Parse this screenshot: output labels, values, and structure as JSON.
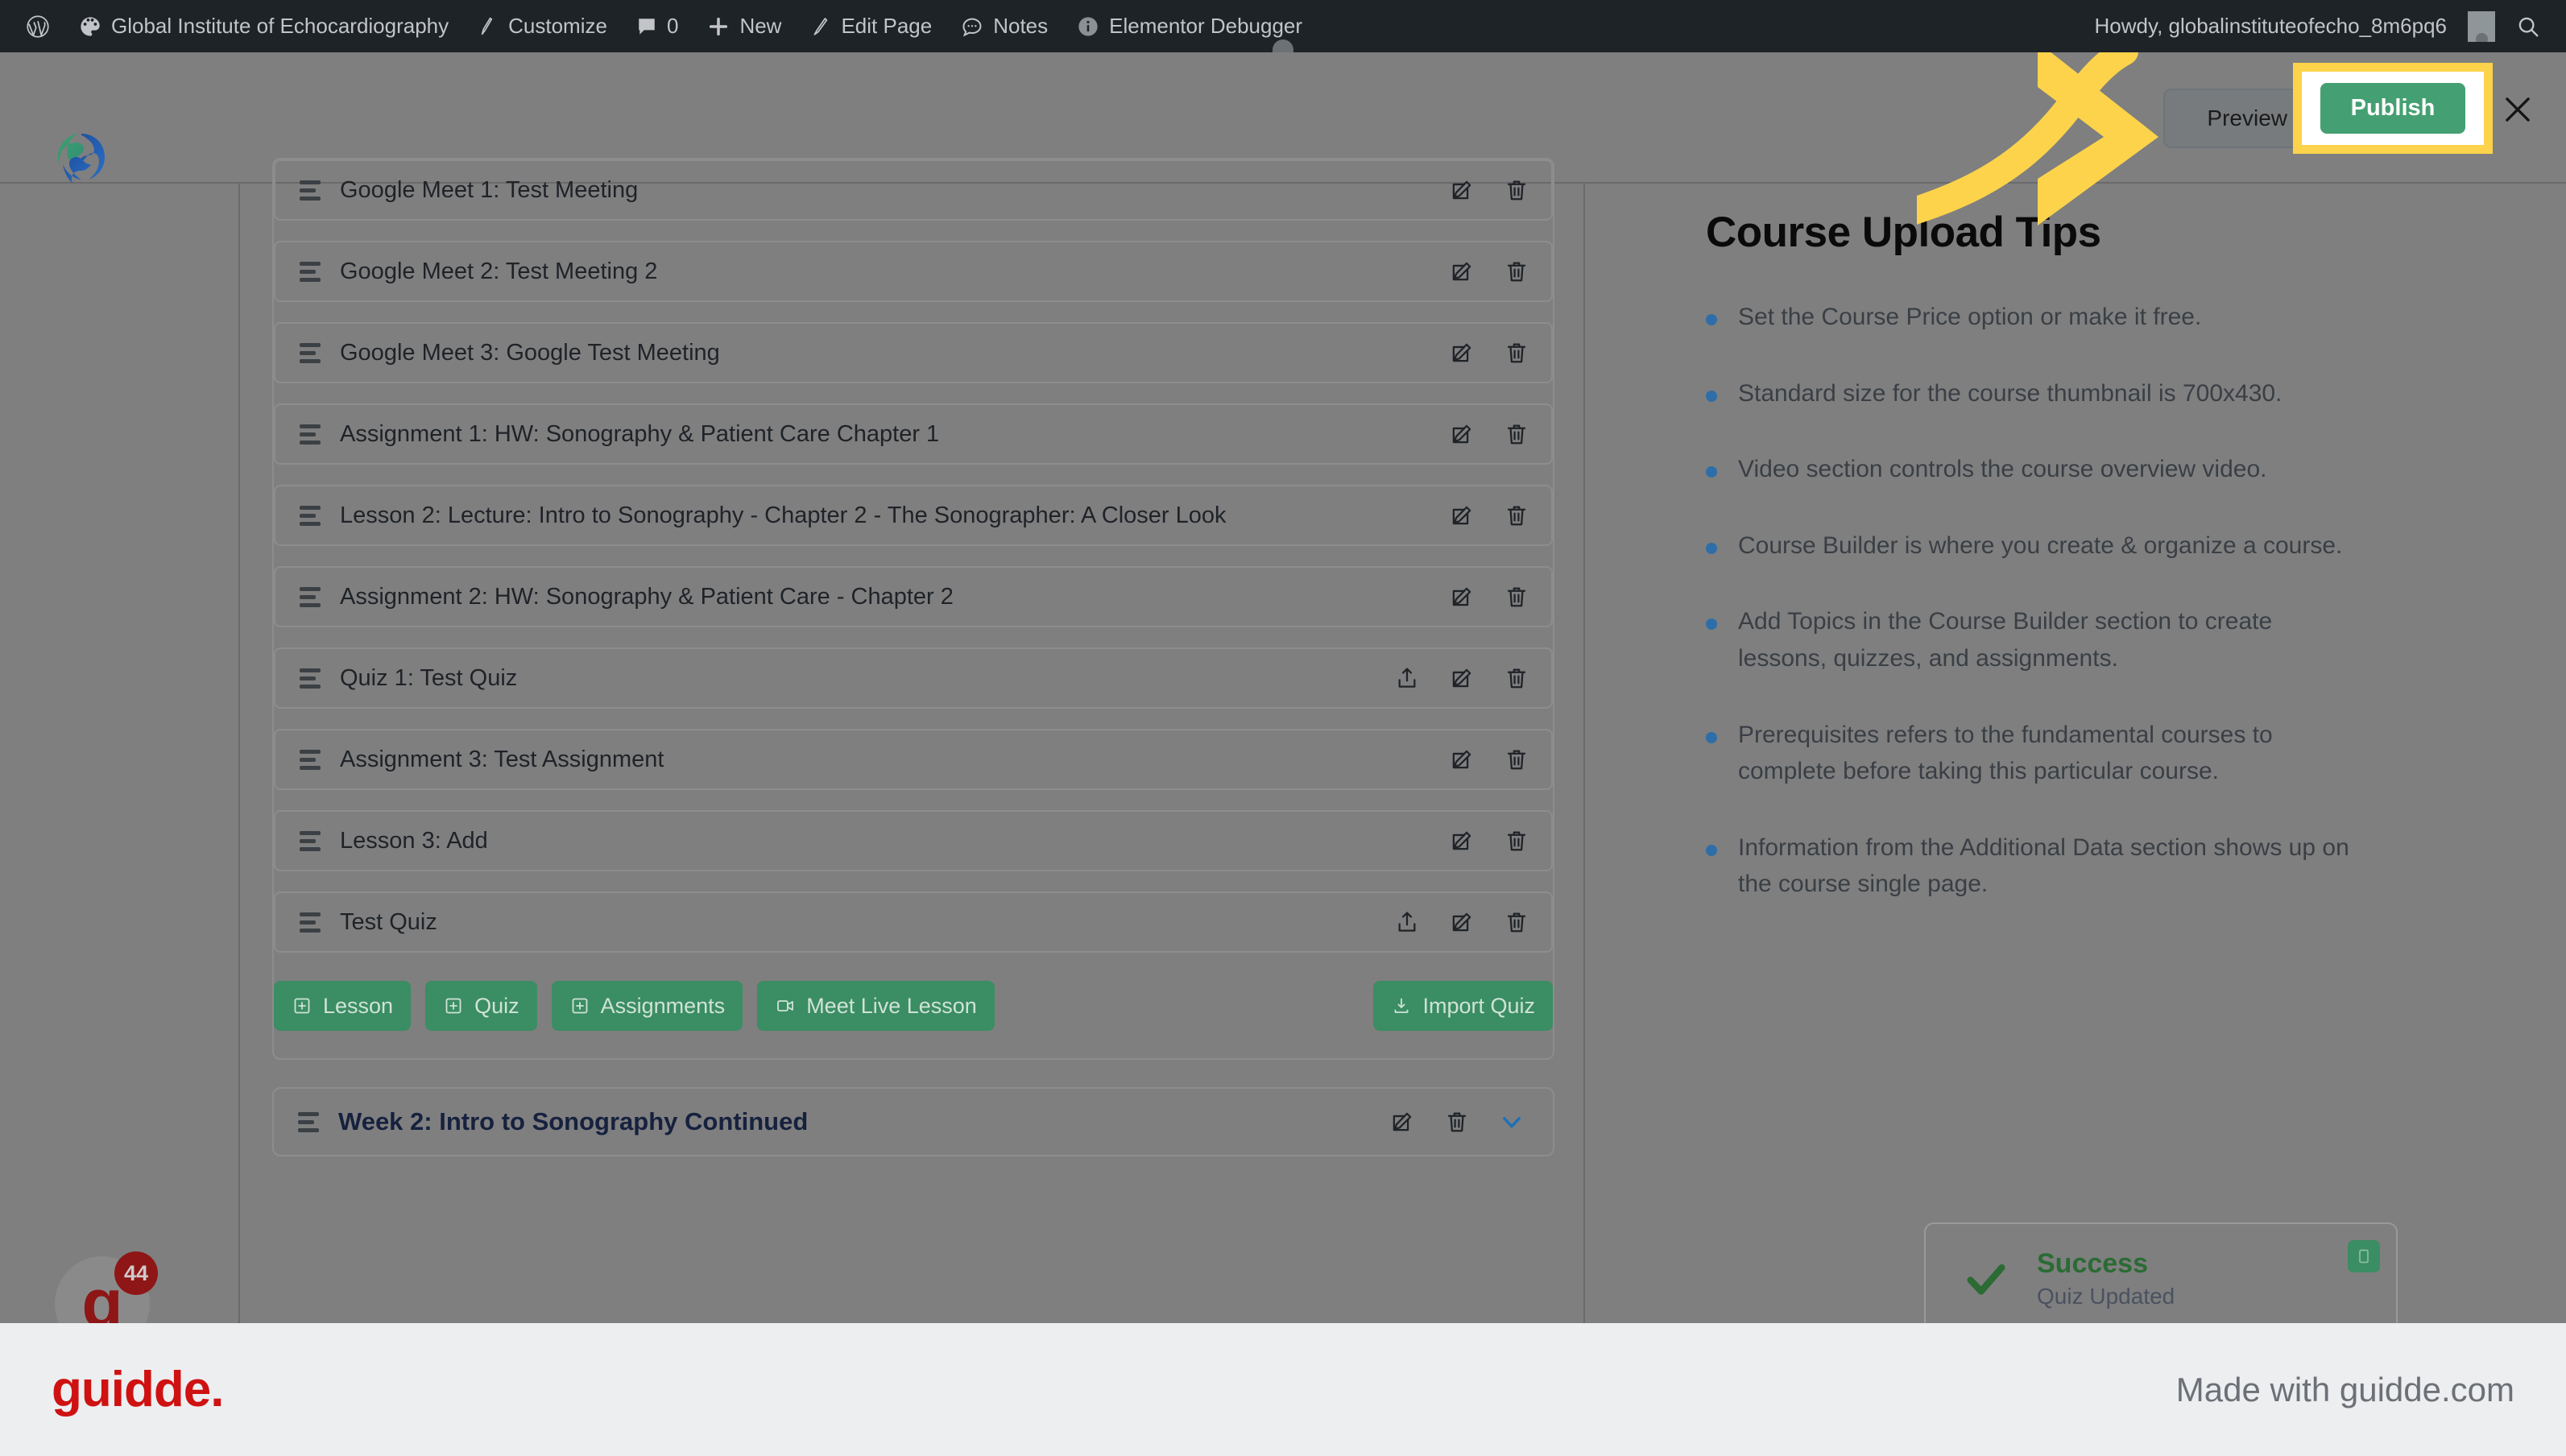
{
  "adminbar": {
    "items": [
      {
        "icon": "wordpress-icon",
        "label": ""
      },
      {
        "icon": "site-icon",
        "label": "Global Institute of Echocardiography"
      },
      {
        "icon": "paintbrush-icon",
        "label": "Customize"
      },
      {
        "icon": "comment-icon",
        "label": "0"
      },
      {
        "icon": "plus-icon",
        "label": "New"
      },
      {
        "icon": "pencil-icon",
        "label": "Edit Page"
      },
      {
        "icon": "notes-icon",
        "label": "Notes"
      },
      {
        "icon": "info-icon",
        "label": "Elementor Debugger"
      }
    ],
    "howdy": "Howdy, globalinstituteofecho_8m6pq6",
    "search_icon": "search-icon"
  },
  "header": {
    "logo_icon": "site-brand-logo",
    "preview_label": "Preview",
    "publish_label": "Publish",
    "close_icon": "close-icon"
  },
  "builder": {
    "items": [
      {
        "title": "Google Meet 1: Test Meeting",
        "has_export": false
      },
      {
        "title": "Google Meet 2: Test Meeting 2",
        "has_export": false
      },
      {
        "title": "Google Meet 3: Google Test Meeting",
        "has_export": false
      },
      {
        "title": "Assignment 1: HW: Sonography & Patient Care Chapter 1",
        "has_export": false
      },
      {
        "title": "Lesson 2: Lecture: Intro to Sonography - Chapter 2 - The Sonographer: A Closer Look",
        "has_export": false
      },
      {
        "title": "Assignment 2: HW: Sonography & Patient Care - Chapter 2",
        "has_export": false
      },
      {
        "title": "Quiz 1: Test Quiz",
        "has_export": true
      },
      {
        "title": "Assignment 3: Test Assignment",
        "has_export": false
      },
      {
        "title": "Lesson 3: Add",
        "has_export": false
      },
      {
        "title": "Test Quiz",
        "has_export": true
      }
    ],
    "add_buttons": [
      {
        "label": "Lesson",
        "icon": "plus-square-icon"
      },
      {
        "label": "Quiz",
        "icon": "plus-square-icon"
      },
      {
        "label": "Assignments",
        "icon": "plus-square-icon"
      },
      {
        "label": "Meet Live Lesson",
        "icon": "video-camera-icon"
      }
    ],
    "import_button": {
      "label": "Import Quiz",
      "icon": "download-icon"
    },
    "next_topic": {
      "title": "Week 2: Intro to Sonography Continued"
    },
    "row_icons": {
      "export": "export-icon",
      "edit": "edit-icon",
      "delete": "trash-icon",
      "collapse": "chevron-down-icon"
    }
  },
  "tips": {
    "title": "Course Upload Tips",
    "bullets": [
      "Set the Course Price option or make it free.",
      "Standard size for the course thumbnail is 700x430.",
      "Video section controls the course overview video.",
      "Course Builder is where you create & organize a course.",
      "Add Topics in the Course Builder section to create lessons, quizzes, and assignments.",
      "Prerequisites refers to the fundamental courses to complete before taking this particular course.",
      "Information from the Additional Data section shows up on the course single page."
    ]
  },
  "toast": {
    "icon": "check-icon",
    "title": "Success",
    "message": "Quiz Updated",
    "badge_icon": "copy-icon"
  },
  "widget": {
    "label": "g",
    "badge_count": "44"
  },
  "footer": {
    "logo": "guidde.",
    "made_with": "Made with guidde.com"
  },
  "colors": {
    "publish_green": "#44a072",
    "button_green": "#3b8d63",
    "highlight_yellow": "#fcd34b",
    "bullet_blue": "#2e6ea8",
    "success_green": "#2b6b34",
    "guidde_red": "#cf1111",
    "adminbar_bg": "#1d2327",
    "overlay_gray": "#7f7f7f"
  }
}
